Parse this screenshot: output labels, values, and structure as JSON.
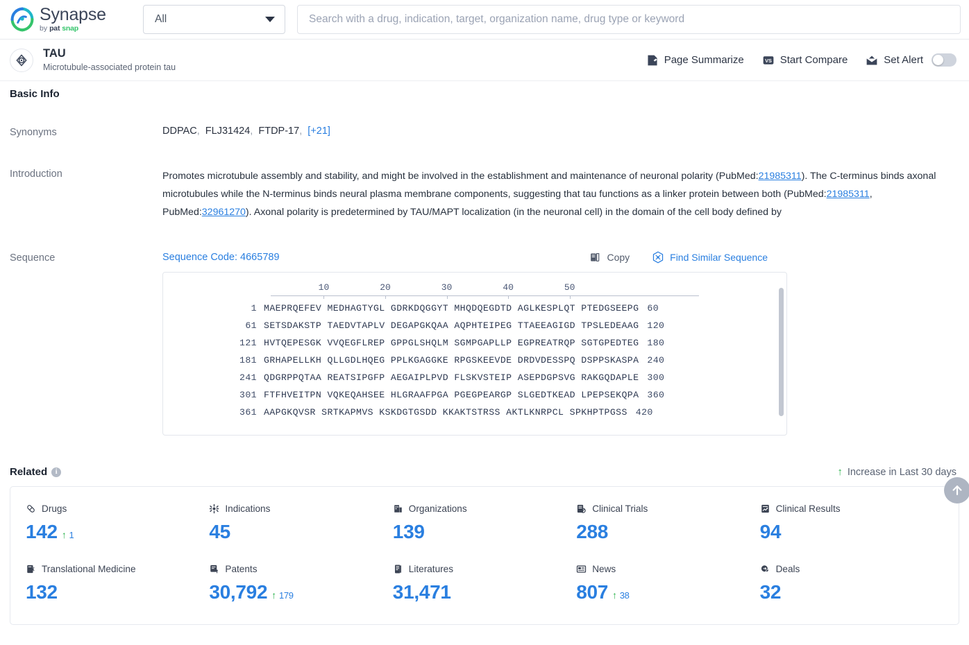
{
  "brand": {
    "name": "Synapse",
    "by": "by",
    "pat": "pat",
    "snap": "snap"
  },
  "search": {
    "scope_selected": "All",
    "placeholder": "Search with a drug, indication, target, organization name, drug type or keyword",
    "value": ""
  },
  "entity": {
    "title": "TAU",
    "subtitle": "Microtubule-associated protein tau",
    "actions": {
      "page_summarize": "Page Summarize",
      "start_compare": "Start Compare",
      "set_alert": "Set Alert",
      "alert_enabled": false
    }
  },
  "basic_info": {
    "heading": "Basic Info",
    "synonyms": {
      "label": "Synonyms",
      "items": [
        "DDPAC",
        "FLJ31424",
        "FTDP-17"
      ],
      "more": "[+21]"
    },
    "introduction": {
      "label": "Introduction",
      "part1": "Promotes microtubule assembly and stability, and might be involved in the establishment and maintenance of neuronal polarity (PubMed:",
      "link1": "21985311",
      "part2": "). The C-terminus binds axonal microtubules while the N-terminus binds neural plasma membrane components, suggesting that tau functions as a linker protein between both (PubMed:",
      "link2": "21985311",
      "part3": ", PubMed:",
      "link3": "32961270",
      "part4": "). Axonal polarity is predetermined by TAU/MAPT localization (in the neuronal cell) in the domain of the cell body defined by"
    },
    "sequence": {
      "label": "Sequence",
      "code_label": "Sequence Code: 4665789",
      "copy_label": "Copy",
      "find_similar_label": "Find Similar Sequence",
      "ruler_ticks": [
        10,
        20,
        30,
        40,
        50
      ],
      "rows": [
        {
          "start": "1",
          "chunks": "MAEPRQEFEV MEDHAGTYGL GDRKDQGGYT MHQDQEGDTD AGLKESPLQT PTEDGSEEPG",
          "end": "60"
        },
        {
          "start": "61",
          "chunks": "SETSDAKSTP TAEDVTAPLV DEGAPGKQAA AQPHTEIPEG TTAEEAGIGD TPSLEDEAAG",
          "end": "120"
        },
        {
          "start": "121",
          "chunks": "HVTQEPESGK VVQEGFLREP GPPGLSHQLM SGMPGAPLLP EGPREATRQP SGTGPEDTEG",
          "end": "180"
        },
        {
          "start": "181",
          "chunks": "GRHAPELLKH QLLGDLHQEG PPLKGAGGKE RPGSKEEVDE DRDVDESSPQ DSPPSKASPA",
          "end": "240"
        },
        {
          "start": "241",
          "chunks": "QDGRPPQTAA REATSIPGFP AEGAIPLPVD FLSKVSTEIP ASEPDGPSVG RAKGQDAPLE",
          "end": "300"
        },
        {
          "start": "301",
          "chunks": "FTFHVEITPN VQKEQAHSEE HLGRAAFPGA PGEGPEARGP SLGEDTKEAD LPEPSEKQPA",
          "end": "360"
        },
        {
          "start": "361",
          "chunks": "AAPGKQVSR SRTKAPMVS KSKDGTGSDD KKAKTSTRSS AKTLKNRPCL SPKHPTPGSS",
          "end": "420"
        }
      ]
    }
  },
  "related": {
    "heading": "Related",
    "increase_note": "Increase in Last 30 days",
    "stats": [
      {
        "icon": "drugs-icon",
        "label": "Drugs",
        "value": "142",
        "delta": "1"
      },
      {
        "icon": "indications-icon",
        "label": "Indications",
        "value": "45",
        "delta": ""
      },
      {
        "icon": "organizations-icon",
        "label": "Organizations",
        "value": "139",
        "delta": ""
      },
      {
        "icon": "clinical-trials-icon",
        "label": "Clinical Trials",
        "value": "288",
        "delta": ""
      },
      {
        "icon": "clinical-results-icon",
        "label": "Clinical Results",
        "value": "94",
        "delta": ""
      },
      {
        "icon": "translational-medicine-icon",
        "label": "Translational Medicine",
        "value": "132",
        "delta": ""
      },
      {
        "icon": "patents-icon",
        "label": "Patents",
        "value": "30,792",
        "delta": "179"
      },
      {
        "icon": "literatures-icon",
        "label": "Literatures",
        "value": "31,471",
        "delta": ""
      },
      {
        "icon": "news-icon",
        "label": "News",
        "value": "807",
        "delta": "38"
      },
      {
        "icon": "deals-icon",
        "label": "Deals",
        "value": "32",
        "delta": ""
      }
    ]
  },
  "colors": {
    "accent_blue": "#2a7fe0",
    "increase_green": "#2bb24c",
    "dark_navy": "#3b4559"
  }
}
